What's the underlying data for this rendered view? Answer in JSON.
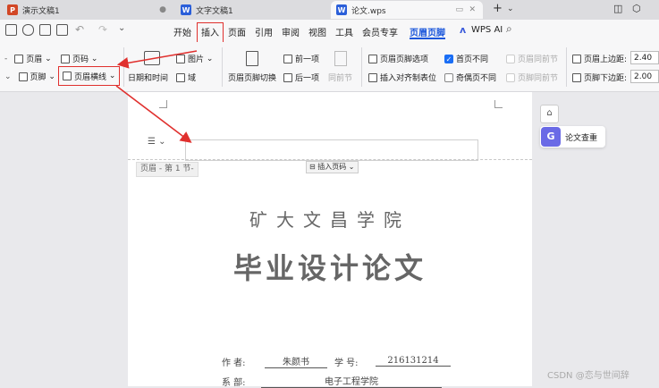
{
  "tabs": [
    {
      "label": "演示文稿1",
      "icon": "P",
      "color": "#d24726"
    },
    {
      "label": "文字文稿1",
      "icon": "W",
      "color": "#2b5fd9"
    },
    {
      "label": "论文.wps",
      "icon": "W",
      "color": "#2b5fd9"
    }
  ],
  "menu": [
    "开始",
    "插入",
    "页面",
    "引用",
    "审阅",
    "视图",
    "工具",
    "会员专享",
    "页眉页脚",
    "WPS AI"
  ],
  "ribbon": {
    "header": "页眉",
    "page_number": "页码",
    "footer": "页脚",
    "header_line": "页眉横线",
    "date_time": "日期和时间",
    "picture": "图片",
    "field": "域",
    "hf_switch": "页眉页脚切换",
    "prev": "前一项",
    "next": "后一项",
    "same_prev": "同前节",
    "hf_options": "页眉页脚选项",
    "insert_tab": "插入对齐制表位",
    "first_diff": "首页不同",
    "odd_even": "奇偶页不同",
    "hdr_same": "页眉同前节",
    "ftr_same": "页脚同前节",
    "top_margin_label": "页眉上边距:",
    "top_margin_value": "2.40",
    "bottom_margin_label": "页脚下边距:",
    "bottom_margin_value": "2.00"
  },
  "doc": {
    "header_label": "页眉 - 第 1 节-",
    "insert_page_num": "插入页码",
    "school": "矿大文昌学院",
    "title": "毕业设计论文",
    "author_label": "作    者:",
    "author": "朱颜书",
    "id_label": "学    号:",
    "id": "216131214",
    "dept_label": "系    部:",
    "dept": "电子工程学院"
  },
  "side": {
    "check_label": "论文查重",
    "check_icon": "G"
  },
  "watermark": "CSDN @恋与世间辞"
}
